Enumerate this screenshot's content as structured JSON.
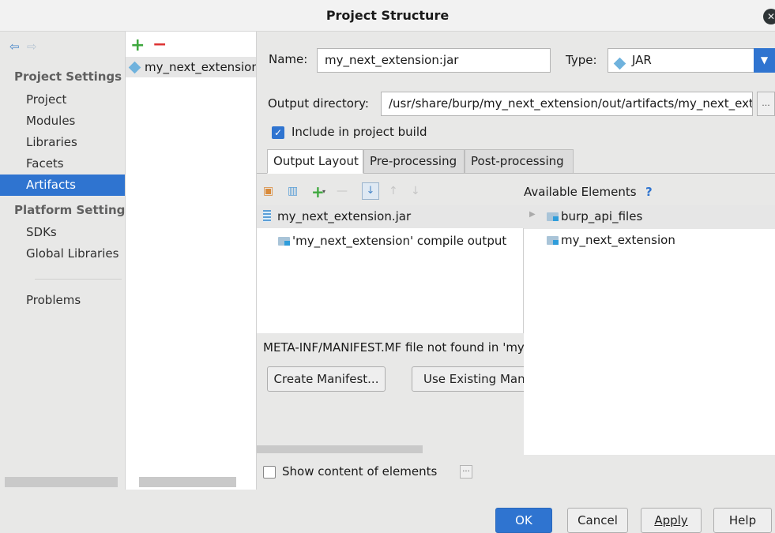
{
  "window": {
    "title": "Project Structure"
  },
  "sidebar": {
    "project_settings_heading": "Project Settings",
    "project_settings_items": [
      "Project",
      "Modules",
      "Libraries",
      "Facets",
      "Artifacts"
    ],
    "selected_item": "Artifacts",
    "platform_settings_heading": "Platform Settings",
    "platform_items": [
      "SDKs",
      "Global Libraries"
    ],
    "problems_label": "Problems"
  },
  "artifacts_list": {
    "items": [
      "my_next_extension:jar"
    ]
  },
  "artifact": {
    "name_label": "Name:",
    "name_value": "my_next_extension:jar",
    "type_label": "Type:",
    "type_value": "JAR",
    "output_dir_label": "Output directory:",
    "output_dir_value": "/usr/share/burp/my_next_extension/out/artifacts/my_next_extension_jar",
    "browse_label": "...",
    "include_build_label": "Include in project build",
    "include_build_checked": true
  },
  "tabs": {
    "output_layout": "Output Layout",
    "pre_processing": "Pre-processing",
    "post_processing": "Post-processing",
    "active": "Output Layout"
  },
  "output_tree": {
    "root": "my_next_extension.jar",
    "children": [
      "'my_next_extension' compile output"
    ]
  },
  "available": {
    "heading": "Available Elements",
    "help": "?",
    "items": [
      "burp_api_files",
      "my_next_extension"
    ]
  },
  "manifest": {
    "message": "META-INF/MANIFEST.MF file not found in 'my_next_extension.jar'",
    "create_label": "Create Manifest...",
    "use_existing_label": "Use Existing Manifest..."
  },
  "show_content": {
    "label": "Show content of elements",
    "checked": false,
    "more_label": "..."
  },
  "footer": {
    "ok": "OK",
    "cancel": "Cancel",
    "apply": "Apply",
    "help": "Help"
  },
  "colors": {
    "accent": "#2f74d0",
    "add": "#3fa83f",
    "remove": "#dd3333"
  }
}
